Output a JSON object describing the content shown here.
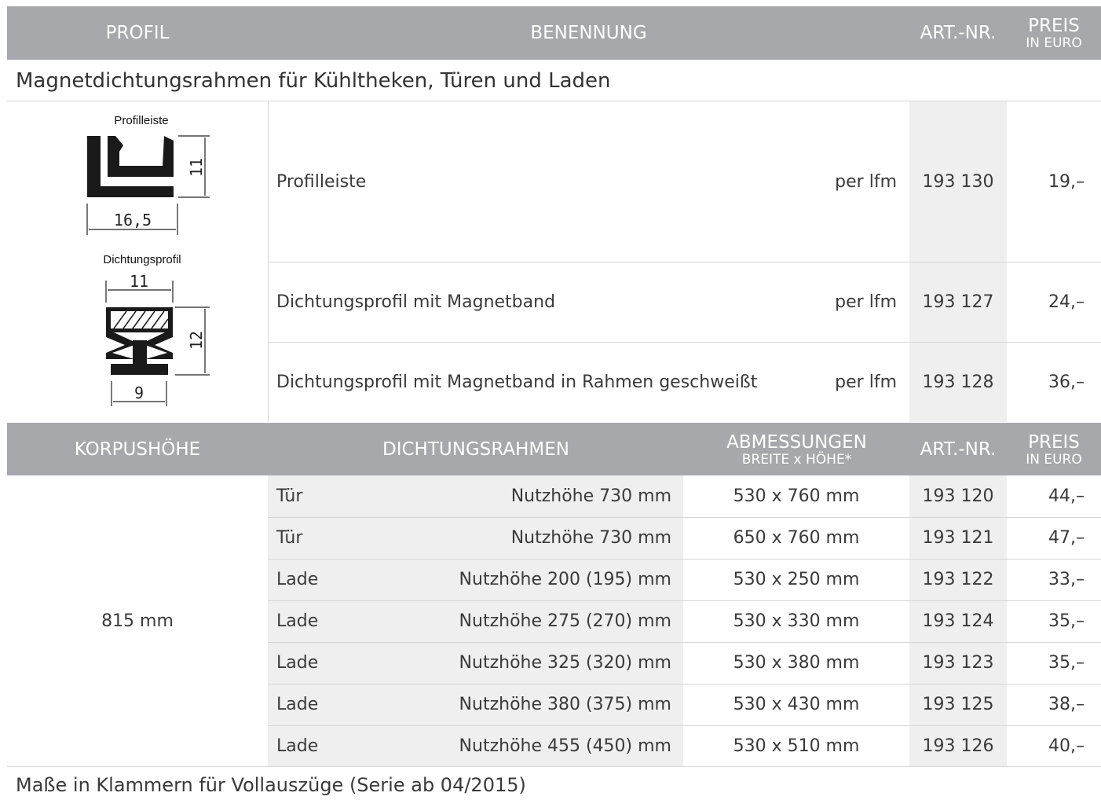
{
  "header1": {
    "profil": "PROFIL",
    "benennung": "BENENNUNG",
    "artnr": "ART.-NR.",
    "preis": "PREIS",
    "preis_sub": "IN EURO"
  },
  "section_title": "Magnetdichtungsrahmen für Kühltheken, Türen und Laden",
  "drawings": {
    "profilleiste": {
      "caption": "Profilleiste",
      "width": "16,5",
      "height": "11"
    },
    "dichtungsprofil": {
      "caption": "Dichtungsprofil",
      "top": "11",
      "height": "12",
      "bottom": "9"
    }
  },
  "products": [
    {
      "name": "Profilleiste",
      "unit": "per lfm",
      "artnr": "193 130",
      "price": "19,–"
    },
    {
      "name": "Dichtungsprofil mit Magnetband",
      "unit": "per lfm",
      "artnr": "193 127",
      "price": "24,–"
    },
    {
      "name": "Dichtungsprofil mit Magnetband in Rahmen geschweißt",
      "unit": "per lfm",
      "artnr": "193 128",
      "price": "36,–"
    }
  ],
  "header2": {
    "korpus": "KORPUSHÖHE",
    "rahmen": "DICHTUNGSRAHMEN",
    "abm": "ABMESSUNGEN",
    "abm_sub": "BREITE x HÖHE*",
    "artnr": "ART.-NR.",
    "preis": "PREIS",
    "preis_sub": "IN EURO"
  },
  "korpus_value": "815 mm",
  "frames": [
    {
      "type": "Tür",
      "nutz": "Nutzhöhe 730 mm",
      "dim": "530 x 760 mm",
      "artnr": "193 120",
      "price": "44,–"
    },
    {
      "type": "Tür",
      "nutz": "Nutzhöhe 730 mm",
      "dim": "650 x 760 mm",
      "artnr": "193 121",
      "price": "47,–"
    },
    {
      "type": "Lade",
      "nutz": "Nutzhöhe 200 (195) mm",
      "dim": "530 x 250 mm",
      "artnr": "193 122",
      "price": "33,–"
    },
    {
      "type": "Lade",
      "nutz": "Nutzhöhe 275 (270) mm",
      "dim": "530 x 330 mm",
      "artnr": "193 124",
      "price": "35,–"
    },
    {
      "type": "Lade",
      "nutz": "Nutzhöhe 325 (320) mm",
      "dim": "530 x 380 mm",
      "artnr": "193 123",
      "price": "35,–"
    },
    {
      "type": "Lade",
      "nutz": "Nutzhöhe 380 (375) mm",
      "dim": "530 x 430 mm",
      "artnr": "193 125",
      "price": "38,–"
    },
    {
      "type": "Lade",
      "nutz": "Nutzhöhe 455 (450) mm",
      "dim": "530 x 510 mm",
      "artnr": "193 126",
      "price": "40,–"
    }
  ],
  "footnote": "Maße in Klammern für Vollauszüge (Serie ab 04/2015)"
}
